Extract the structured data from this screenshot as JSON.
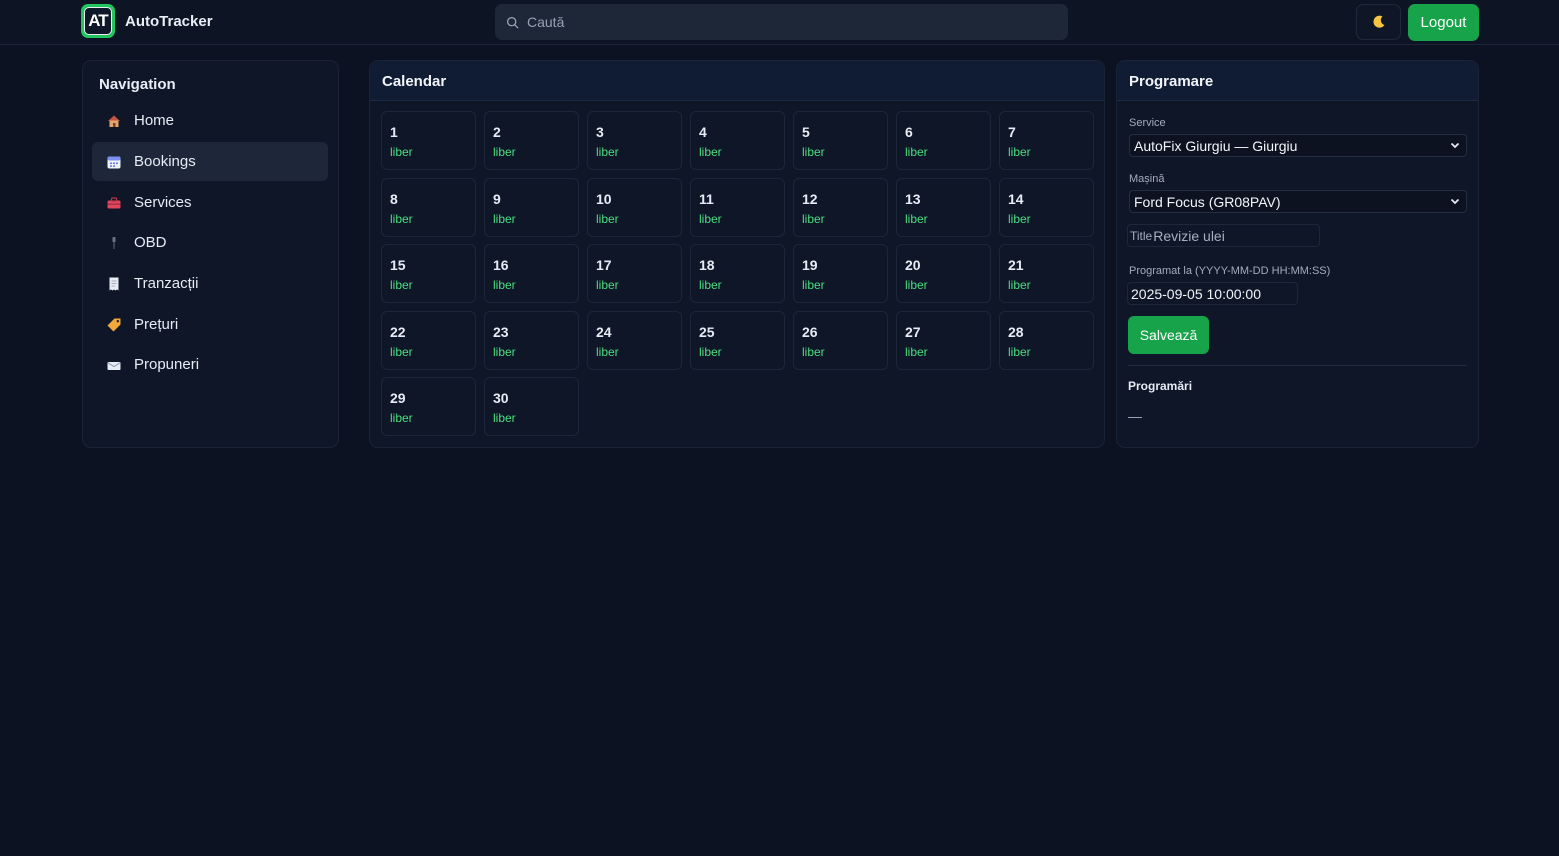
{
  "app": {
    "logo_text": "AT",
    "name": "AutoTracker"
  },
  "search": {
    "placeholder": "Caută"
  },
  "header": {
    "theme_icon": "moon-icon",
    "logout_label": "Logout"
  },
  "nav": {
    "title": "Navigation",
    "items": [
      {
        "label": "Home",
        "icon": "house-icon",
        "active": false
      },
      {
        "label": "Bookings",
        "icon": "calendar-icon",
        "active": true
      },
      {
        "label": "Services",
        "icon": "toolbox-icon",
        "active": false
      },
      {
        "label": "OBD",
        "icon": "plug-icon",
        "active": false
      },
      {
        "label": "Tranzacții",
        "icon": "receipt-icon",
        "active": false
      },
      {
        "label": "Prețuri",
        "icon": "tag-icon",
        "active": false
      },
      {
        "label": "Propuneri",
        "icon": "envelope-icon",
        "active": false
      }
    ]
  },
  "calendar": {
    "title": "Calendar",
    "days": [
      {
        "n": "1",
        "s": "liber"
      },
      {
        "n": "2",
        "s": "liber"
      },
      {
        "n": "3",
        "s": "liber"
      },
      {
        "n": "4",
        "s": "liber"
      },
      {
        "n": "5",
        "s": "liber"
      },
      {
        "n": "6",
        "s": "liber"
      },
      {
        "n": "7",
        "s": "liber"
      },
      {
        "n": "8",
        "s": "liber"
      },
      {
        "n": "9",
        "s": "liber"
      },
      {
        "n": "10",
        "s": "liber"
      },
      {
        "n": "11",
        "s": "liber"
      },
      {
        "n": "12",
        "s": "liber"
      },
      {
        "n": "13",
        "s": "liber"
      },
      {
        "n": "14",
        "s": "liber"
      },
      {
        "n": "15",
        "s": "liber"
      },
      {
        "n": "16",
        "s": "liber"
      },
      {
        "n": "17",
        "s": "liber"
      },
      {
        "n": "18",
        "s": "liber"
      },
      {
        "n": "19",
        "s": "liber"
      },
      {
        "n": "20",
        "s": "liber"
      },
      {
        "n": "21",
        "s": "liber"
      },
      {
        "n": "22",
        "s": "liber"
      },
      {
        "n": "23",
        "s": "liber"
      },
      {
        "n": "24",
        "s": "liber"
      },
      {
        "n": "25",
        "s": "liber"
      },
      {
        "n": "26",
        "s": "liber"
      },
      {
        "n": "27",
        "s": "liber"
      },
      {
        "n": "28",
        "s": "liber"
      },
      {
        "n": "29",
        "s": "liber"
      },
      {
        "n": "30",
        "s": "liber"
      }
    ]
  },
  "programare": {
    "title": "Programare",
    "service_label": "Service",
    "service_value": "AutoFix Giurgiu — Giurgiu",
    "car_label": "Mașină",
    "car_value": "Ford Focus (GR08PAV)",
    "title_label": "Title",
    "title_value": "Revizie ulei",
    "date_label": "Programat la (YYYY-MM-DD HH:MM:SS)",
    "date_value": "2025-09-05 10:00:00",
    "save_label": "Salvează",
    "list_title": "Programări",
    "list_empty": "—"
  },
  "colors": {
    "background": "#0c1221",
    "accent_green": "#16a34a",
    "status_free": "#4ade80"
  }
}
